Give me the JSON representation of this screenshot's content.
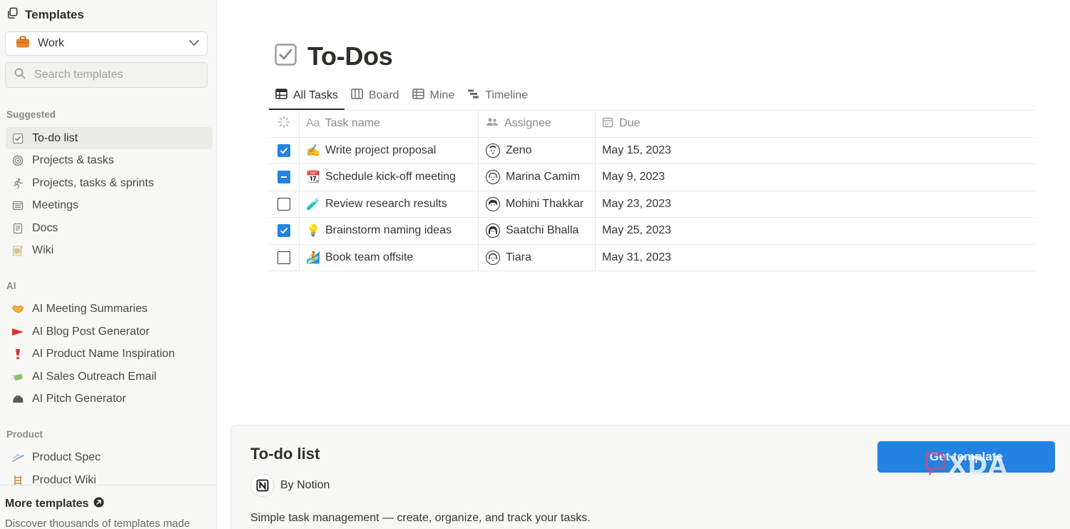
{
  "sidebar": {
    "header": {
      "title": "Templates"
    },
    "category": {
      "label": "Work",
      "icon": "briefcase-icon"
    },
    "search": {
      "placeholder": "Search templates"
    },
    "sections": {
      "suggested": "Suggested",
      "ai": "AI",
      "product": "Product"
    },
    "suggested_items": [
      {
        "label": "To-do list",
        "icon": "checkbox-icon",
        "active": true
      },
      {
        "label": "Projects & tasks",
        "icon": "target-icon"
      },
      {
        "label": "Projects, tasks & sprints",
        "icon": "runner-icon"
      },
      {
        "label": "Meetings",
        "icon": "calendar-list-icon"
      },
      {
        "label": "Docs",
        "icon": "document-icon"
      },
      {
        "label": "Wiki",
        "icon": "memo-icon"
      }
    ],
    "ai_items": [
      {
        "label": "AI Meeting Summaries",
        "icon": "handshake-icon"
      },
      {
        "label": "AI Blog Post Generator",
        "icon": "red-flag-icon"
      },
      {
        "label": "AI Product Name Inspiration",
        "icon": "exclamation-icon"
      },
      {
        "label": "AI Sales Outreach Email",
        "icon": "money-wings-icon"
      },
      {
        "label": "AI Pitch Generator",
        "icon": "rock-icon"
      }
    ],
    "product_items": [
      {
        "label": "Product Spec",
        "icon": "ski-icon"
      },
      {
        "label": "Product Wiki",
        "icon": "ladder-icon"
      }
    ],
    "more": {
      "title": "More templates",
      "description": "Discover thousands of templates made"
    }
  },
  "page": {
    "title": "To-Dos",
    "tabs": [
      {
        "label": "All Tasks",
        "icon": "table-icon",
        "active": true
      },
      {
        "label": "Board",
        "icon": "board-icon"
      },
      {
        "label": "Mine",
        "icon": "table-icon"
      },
      {
        "label": "Timeline",
        "icon": "timeline-icon"
      }
    ],
    "table": {
      "columns": {
        "task": "Task name",
        "task_prefix": "Aa",
        "assignee": "Assignee",
        "due": "Due"
      },
      "rows": [
        {
          "status": "checked",
          "emoji": "✍️",
          "task": "Write project proposal",
          "assignee": "Zeno",
          "due": "May 15, 2023"
        },
        {
          "status": "partial",
          "emoji": "📆",
          "task": "Schedule kick-off meeting",
          "assignee": "Marina Camim",
          "due": "May 9, 2023"
        },
        {
          "status": "empty",
          "emoji": "🧪",
          "task": "Review research results",
          "assignee": "Mohini Thakkar",
          "due": "May 23, 2023"
        },
        {
          "status": "checked",
          "emoji": "💡",
          "task": "Brainstorm naming ideas",
          "assignee": "Saatchi Bhalla",
          "due": "May 25, 2023"
        },
        {
          "status": "empty",
          "emoji": "🏄",
          "task": "Book team offsite",
          "assignee": "Tiara",
          "due": "May 31, 2023"
        }
      ]
    }
  },
  "panel": {
    "title": "To-do list",
    "author": "By Notion",
    "description": "Simple task management — create, organize, and track your tasks.",
    "button": "Get template"
  },
  "watermark": {
    "text": "XDA"
  },
  "colors": {
    "accent": "#2383e2",
    "sidebar_bg": "#f7f7f5",
    "text": "#37352f"
  }
}
